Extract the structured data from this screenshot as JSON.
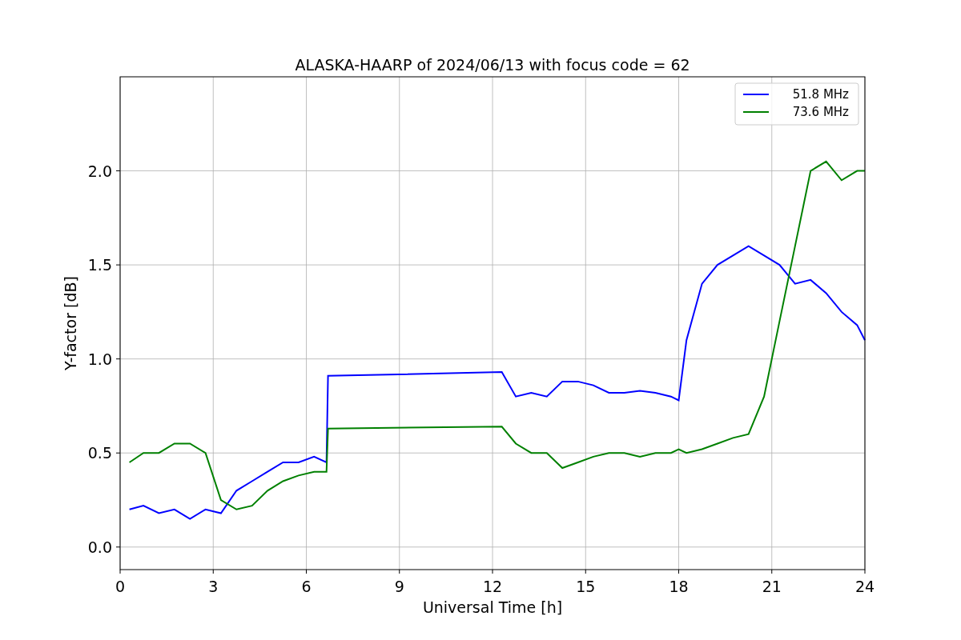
{
  "figure": {
    "chart_data": {
      "type": "line",
      "title": "ALASKA-HAARP of 2024/06/13 with focus code = 62",
      "xlabel": "Universal Time [h]",
      "ylabel": "Y-factor [dB]",
      "x": [
        0.3,
        0.75,
        1.25,
        1.75,
        2.25,
        2.75,
        3.25,
        3.75,
        4.25,
        4.75,
        5.25,
        5.75,
        6.25,
        6.65,
        6.7,
        12.3,
        12.75,
        13.25,
        13.75,
        14.25,
        14.75,
        15.25,
        15.75,
        16.25,
        16.75,
        17.25,
        17.75,
        18.0,
        18.25,
        18.75,
        19.25,
        19.75,
        20.25,
        20.75,
        21.25,
        21.75,
        22.25,
        22.75,
        23.25,
        23.75,
        24
      ],
      "series": [
        {
          "name": "51.8 MHz",
          "color": "#0000ff",
          "values": [
            0.2,
            0.22,
            0.18,
            0.2,
            0.15,
            0.2,
            0.18,
            0.3,
            0.35,
            0.4,
            0.45,
            0.45,
            0.48,
            0.45,
            0.91,
            0.93,
            0.8,
            0.82,
            0.8,
            0.88,
            0.88,
            0.86,
            0.82,
            0.82,
            0.83,
            0.82,
            0.8,
            0.78,
            1.1,
            1.4,
            1.5,
            1.55,
            1.6,
            1.55,
            1.5,
            1.4,
            1.42,
            1.35,
            1.25,
            1.18,
            1.1
          ]
        },
        {
          "name": "73.6 MHz",
          "color": "#008000",
          "values": [
            0.45,
            0.5,
            0.5,
            0.55,
            0.55,
            0.5,
            0.25,
            0.2,
            0.22,
            0.3,
            0.35,
            0.38,
            0.4,
            0.4,
            0.63,
            0.64,
            0.55,
            0.5,
            0.5,
            0.42,
            0.45,
            0.48,
            0.5,
            0.5,
            0.48,
            0.5,
            0.5,
            0.52,
            0.5,
            0.52,
            0.55,
            0.58,
            0.6,
            0.8,
            1.2,
            1.6,
            2.0,
            2.05,
            1.95,
            2.0,
            2.0
          ]
        }
      ],
      "grid": true,
      "legend": true,
      "xlim": [
        0,
        24
      ],
      "ylim": [
        -0.12,
        2.5
      ],
      "xticks": [
        0,
        3,
        6,
        9,
        12,
        15,
        18,
        21,
        24
      ],
      "yticks": [
        {
          "value": 0,
          "label": "0.0"
        },
        {
          "value": 0.5,
          "label": "0.5"
        },
        {
          "value": 1,
          "label": "1.0"
        },
        {
          "value": 1.5,
          "label": "1.5"
        },
        {
          "value": 2,
          "label": "2.0"
        }
      ]
    }
  }
}
